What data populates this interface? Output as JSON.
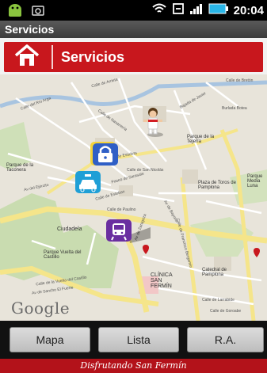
{
  "status_bar": {
    "time": "20:04",
    "icons": [
      "android-icon",
      "image-icon",
      "wifi-icon",
      "sync-icon",
      "signal-icon",
      "battery-icon"
    ]
  },
  "app": {
    "title": "Servicios"
  },
  "header": {
    "title": "Servicios",
    "home_icon": "home-icon"
  },
  "map": {
    "provider": "Google",
    "streets": [
      "Calle de Arrieta",
      "Calle de Navarrería",
      "Calle del Río Arga",
      "Calle de Bretón",
      "Bajada de Javier",
      "Burlada Botea",
      "Calle de Estafeta",
      "Calle de San Nicolás",
      "Av del Ejército",
      "Calle de Paulino",
      "Paseo de Sarasate",
      "Calle de Esteban",
      "Av de Zaragoza",
      "Calle de Francisco Bergamín",
      "Av de Bayona",
      "Calle de Larrabide",
      "Calle de Goroabe",
      "Av de Sancho El Fuerte",
      "Calle de la Vuelta del Castillo"
    ],
    "places": [
      "Parque de la Taconera",
      "Plaza de Toros de Pamplona",
      "Parque de la Tejería",
      "Ciudadela",
      "Parque Vuelta del Castillo",
      "CLÍNICA SAN FERMÍN",
      "Catedral de Pamplona",
      "Parque Media Luna"
    ],
    "markers": [
      "person-icon",
      "lock-icon",
      "taxi-icon",
      "train-icon"
    ]
  },
  "buttons": {
    "mapa": "Mapa",
    "lista": "Lista",
    "ra": "R.A."
  },
  "footer": {
    "tagline": "Disfrutando San Fermín"
  },
  "colors": {
    "brand_red": "#c8171d",
    "map_bg": "#e9e5dc"
  }
}
